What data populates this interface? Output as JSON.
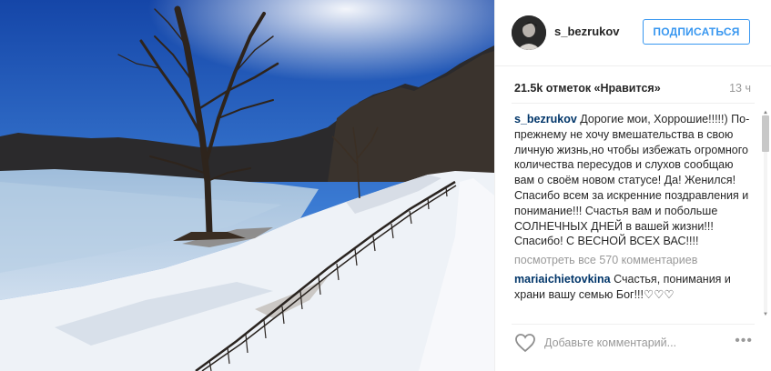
{
  "post": {
    "username": "s_bezrukov",
    "follow_label": "ПОДПИСАТЬСЯ",
    "likes_text": "21.5k отметок «Нравится»",
    "time_ago": "13 ч",
    "caption": {
      "username": "s_bezrukov",
      "text": "Дорогие мои, Хоррошие!!!!!) По-прежнему не хочу вмешательства в свою личную жизнь,но чтобы избежать огромного количества пересудов и слухов сообщаю вам о своём новом статусе! Да! Женился! Спасибо всем за искренние поздравления и понимание!!! Счастья вам и побольше СОЛНЕЧНЫХ ДНЕЙ в вашей жизни!!! Спасибо! С ВЕСНОЙ ВСЕХ ВАС!!!!"
    },
    "load_more": "посмотреть все 570 комментариев",
    "comments": [
      {
        "username": "mariaichietovkina",
        "text": "Счастья, понимания и храни вашу семью Бог!!!♡♡♡"
      }
    ],
    "comment_placeholder": "Добавьте комментарий...",
    "more_options": "•••"
  },
  "icons": {
    "heart": "heart-outline-icon",
    "more": "ellipsis-icon",
    "avatar": "profile-avatar"
  },
  "colors": {
    "accent": "#3897f0",
    "username_link": "#003569",
    "muted": "#999999",
    "border": "#efefef",
    "sky_top": "#1a55b8",
    "snow": "#f3f5f8",
    "ice": "#a9c6e0"
  }
}
